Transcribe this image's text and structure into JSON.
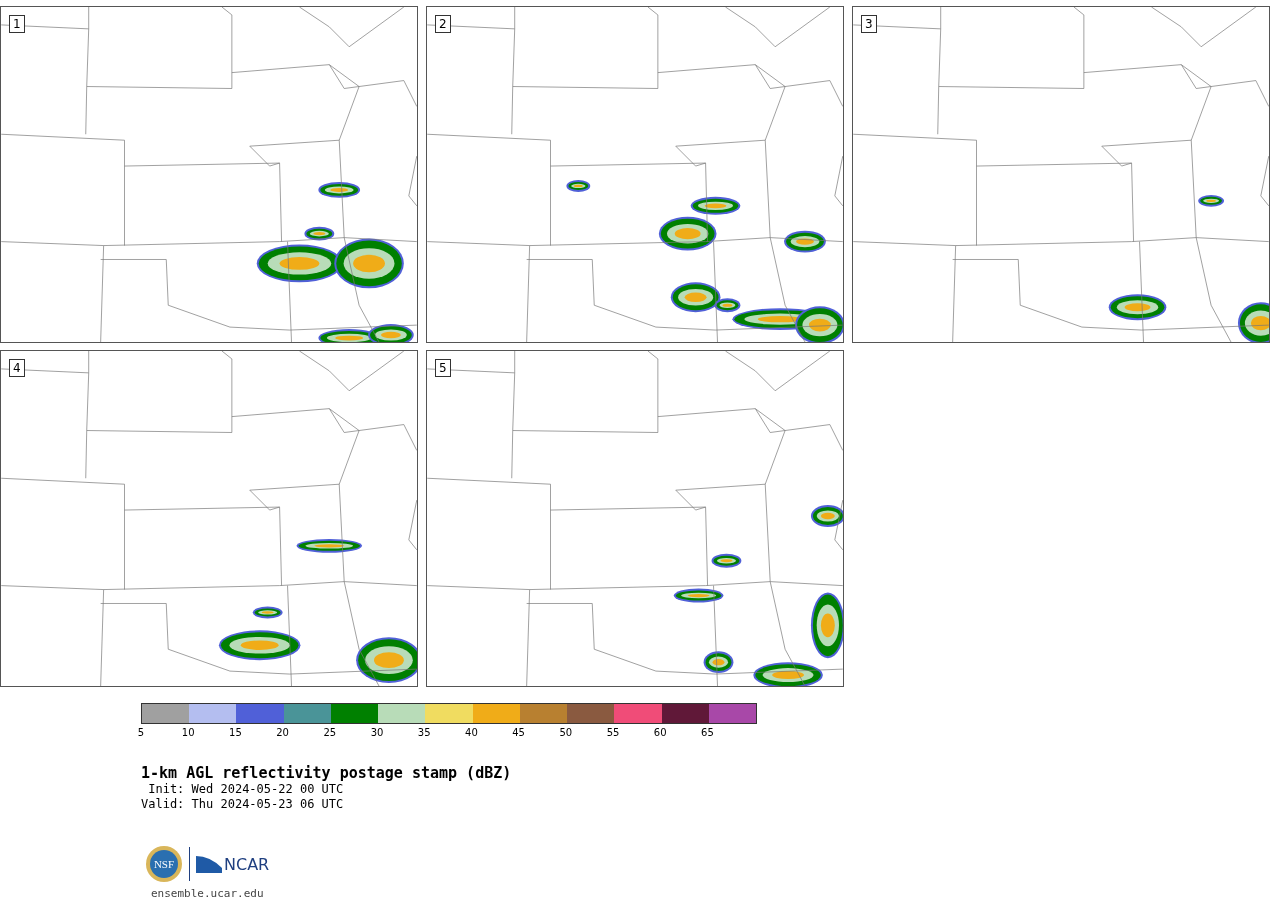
{
  "panels": [
    {
      "number": "1"
    },
    {
      "number": "2"
    },
    {
      "number": "3"
    },
    {
      "number": "4"
    },
    {
      "number": "5"
    }
  ],
  "colorbar": {
    "segments": [
      {
        "color": "#a0a0a0"
      },
      {
        "color": "#b4bef0"
      },
      {
        "color": "#5060d8"
      },
      {
        "color": "#4a9498"
      },
      {
        "color": "#008000"
      },
      {
        "color": "#b8dcb8"
      },
      {
        "color": "#f0dc60"
      },
      {
        "color": "#f0ac18"
      },
      {
        "color": "#b88030"
      },
      {
        "color": "#8a5a40"
      },
      {
        "color": "#f04c78"
      },
      {
        "color": "#601838"
      },
      {
        "color": "#a848a8"
      }
    ],
    "ticks": [
      "5",
      "10",
      "15",
      "20",
      "25",
      "30",
      "35",
      "40",
      "45",
      "50",
      "55",
      "60",
      "65"
    ]
  },
  "title": "1-km AGL reflectivity postage stamp (dBZ)",
  "init": "Init: Wed 2024-05-22 00 UTC",
  "valid": "Valid: Thu 2024-05-23 06 UTC",
  "logos": {
    "nsf": "NSF",
    "ncar": "NCAR"
  },
  "site": "ensemble.ucar.edu"
}
